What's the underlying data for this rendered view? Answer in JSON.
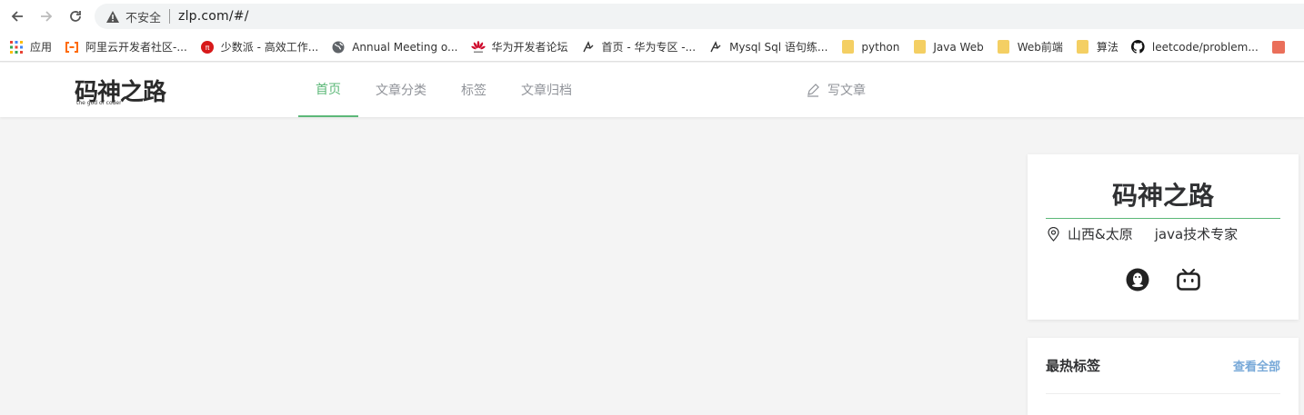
{
  "browser": {
    "security_label": "不安全",
    "url": "zlp.com/#/",
    "bookmarks": [
      {
        "label": "应用",
        "icon": "apps-grid-icon"
      },
      {
        "label": "阿里云开发者社区-...",
        "icon": "aliyun-icon"
      },
      {
        "label": "少数派 - 高效工作...",
        "icon": "sspai-icon"
      },
      {
        "label": "Annual Meeting o...",
        "icon": "globe-icon"
      },
      {
        "label": "华为开发者论坛",
        "icon": "huawei-icon"
      },
      {
        "label": "首页 - 华为专区 -...",
        "icon": "csdn-icon"
      },
      {
        "label": "Mysql Sql 语句练...",
        "icon": "csdn-icon"
      },
      {
        "label": "python",
        "icon": "folder-icon"
      },
      {
        "label": "Java Web",
        "icon": "folder-icon"
      },
      {
        "label": "Web前端",
        "icon": "folder-icon"
      },
      {
        "label": "算法",
        "icon": "folder-icon"
      },
      {
        "label": "leetcode/problem...",
        "icon": "github-icon"
      }
    ]
  },
  "site": {
    "logo_text": "码神之路",
    "logo_sub": "the god of coder",
    "nav": [
      "首页",
      "文章分类",
      "标签",
      "文章归档"
    ],
    "write_label": "写文章"
  },
  "profile": {
    "name": "码神之路",
    "location": "山西&太原",
    "title": "java技术专家",
    "social": [
      "qq-icon",
      "bilibili-icon"
    ]
  },
  "tags_card": {
    "title": "最热标签",
    "view_all": "查看全部"
  },
  "colors": {
    "accent_green": "#5cb878",
    "link_blue": "#78a9d8",
    "folder_yellow": "#f4cf63"
  }
}
